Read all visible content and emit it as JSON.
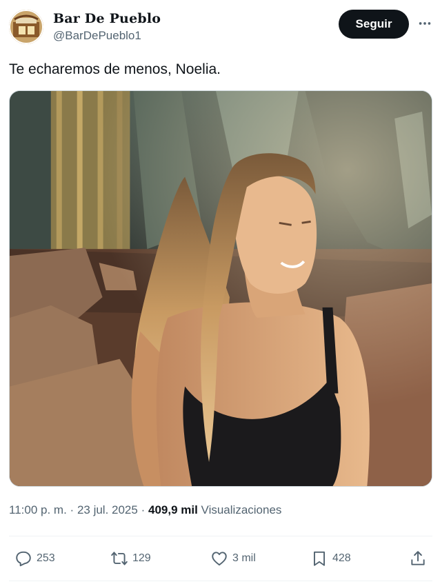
{
  "account": {
    "name": "Bar De Pueblo",
    "handle": "@BarDePueblo1",
    "follow_label": "Seguir"
  },
  "tweet": {
    "text": "Te echaremos de menos, Noelia.",
    "time": "11:00 p. m.",
    "separator": "·",
    "date": "23 jul. 2025",
    "views_count": "409,9 mil",
    "views_label": "Visualizaciones"
  },
  "actions": {
    "replies": "253",
    "reposts": "129",
    "likes": "3 mil",
    "bookmarks": "428"
  },
  "icons": {
    "more": "more-horizontal-icon",
    "reply": "reply-icon",
    "repost": "repost-icon",
    "like": "heart-icon",
    "bookmark": "bookmark-icon",
    "share": "share-icon"
  },
  "colors": {
    "primary_text": "#0f1419",
    "secondary_text": "#536471",
    "button_bg": "#0f1419",
    "divider": "#eff3f4"
  }
}
